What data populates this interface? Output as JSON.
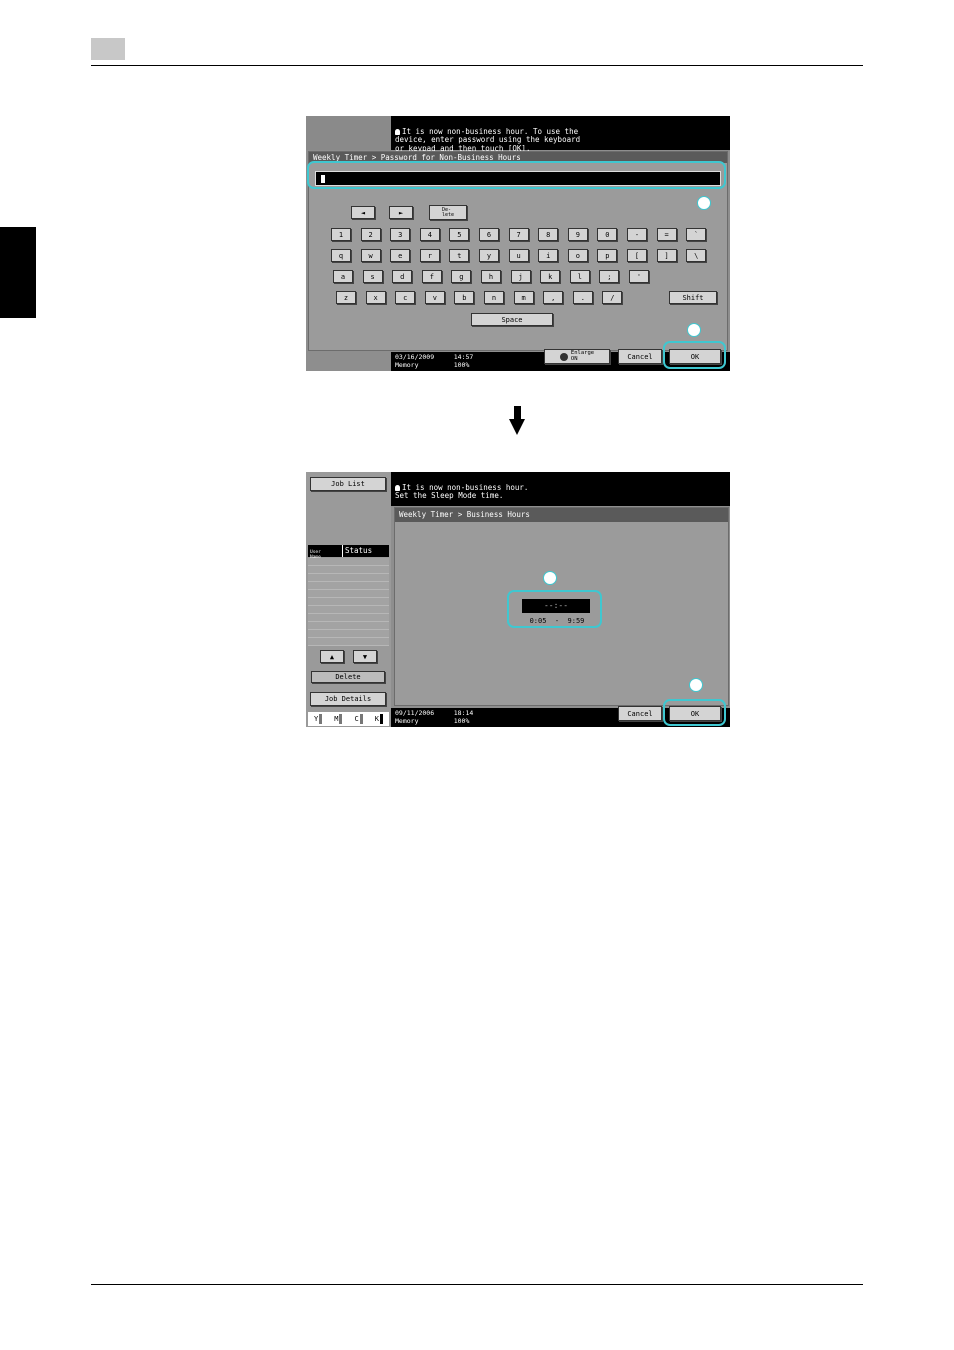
{
  "screen1": {
    "message": "It is now non-business hour. To use the\ndevice, enter password using the keyboard\nor keypad and then touch [OK].",
    "breadcrumb": "Weekly Timer > Password for Non-Business Hours",
    "arrow_left": "◄",
    "arrow_right": "►",
    "delete_label": "De-\nlete",
    "row1": [
      "1",
      "2",
      "3",
      "4",
      "5",
      "6",
      "7",
      "8",
      "9",
      "0",
      "-",
      "=",
      "`"
    ],
    "row2": [
      "q",
      "w",
      "e",
      "r",
      "t",
      "y",
      "u",
      "i",
      "o",
      "p",
      "[",
      "]",
      "\\"
    ],
    "row3": [
      "a",
      "s",
      "d",
      "f",
      "g",
      "h",
      "j",
      "k",
      "l",
      ";",
      "'"
    ],
    "row4": [
      "z",
      "x",
      "c",
      "v",
      "b",
      "n",
      "m",
      ",",
      ".",
      "/"
    ],
    "shift_label": "Shift",
    "space_label": "Space",
    "date": "03/16/2009",
    "time": "14:57",
    "memory_label": "Memory",
    "memory_value": "100%",
    "enlarge_label": "Enlarge\nON",
    "cancel_label": "Cancel",
    "ok_label": "OK"
  },
  "screen2": {
    "job_list_label": "Job List",
    "message": "It is now non-business hour.\nSet the Sleep Mode time.",
    "breadcrumb": "Weekly Timer > Business Hours",
    "user_name_label": "User\nName",
    "status_label": "Status",
    "up_arrow": "▲",
    "down_arrow": "▼",
    "delete_label": "Delete",
    "job_details_label": "Job Details",
    "toner": [
      "Y",
      "M",
      "C",
      "K"
    ],
    "time_display": "--:--",
    "range": "0:05  -  9:59",
    "date": "09/11/2006",
    "time": "18:14",
    "memory_label": "Memory",
    "memory_value": "100%",
    "cancel_label": "Cancel",
    "ok_label": "OK"
  },
  "down_arrow_icon": "arrow-down"
}
